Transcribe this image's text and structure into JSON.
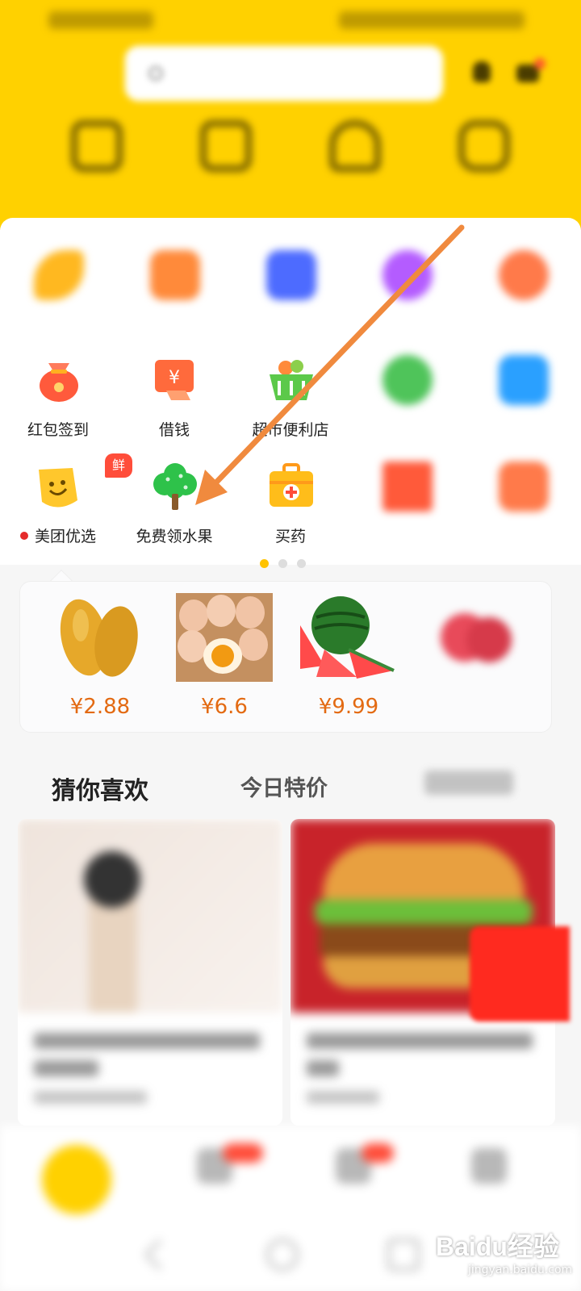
{
  "colors": {
    "header": "#ffd100",
    "price": "#e36a12",
    "arrow": "#f08a3e",
    "active_dot": "#ffc300"
  },
  "grid": {
    "row2": [
      {
        "label": "红包签到",
        "icon": "red-envelope-icon"
      },
      {
        "label": "借钱",
        "icon": "yuan-card-icon"
      },
      {
        "label": "超市便利店",
        "icon": "basket-icon"
      }
    ],
    "row3": [
      {
        "label": "美团优选",
        "icon": "smiley-bag-icon",
        "badge": "鲜"
      },
      {
        "label": "免费领水果",
        "icon": "tree-icon"
      },
      {
        "label": "买药",
        "icon": "medicine-box-icon"
      }
    ]
  },
  "pager": {
    "pages": 3,
    "active": 0
  },
  "products": [
    {
      "name": "mango",
      "price": "¥2.88"
    },
    {
      "name": "eggs",
      "price": "¥6.6"
    },
    {
      "name": "watermelon",
      "price": "¥9.99"
    }
  ],
  "tabs": [
    {
      "label": "猜你喜欢",
      "active": true
    },
    {
      "label": "今日特价",
      "active": false
    }
  ],
  "watermark": {
    "brand": "Baidu经验",
    "url": "jingyan.baidu.com"
  }
}
